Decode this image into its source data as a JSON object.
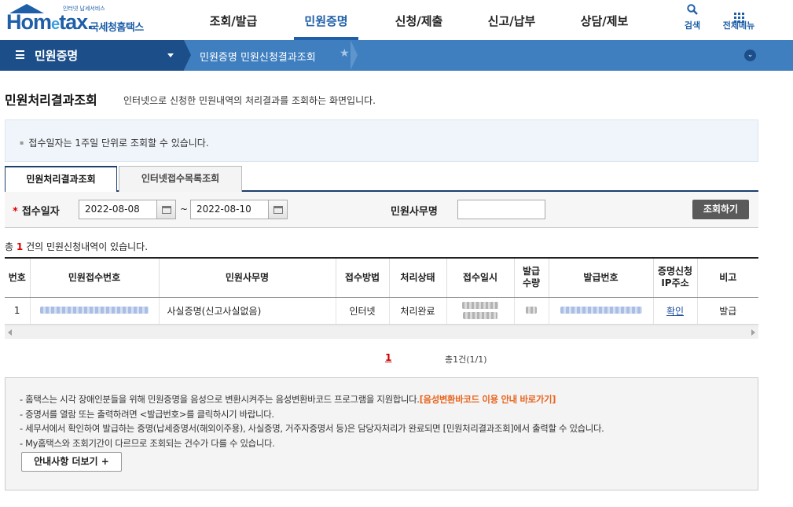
{
  "header": {
    "logo_small": "인터넷 납세서비스",
    "logo_word_a": "Hom",
    "logo_word_e": "e",
    "logo_word_b": "tax.",
    "logo_name": "국세청홈택스",
    "nav": [
      "조회/발급",
      "민원증명",
      "신청/제출",
      "신고/납부",
      "상담/제보"
    ],
    "active_nav": "민원증명",
    "search_label": "검색",
    "allmenu_label": "전체메뉴"
  },
  "location": {
    "depth1": "민원증명",
    "crumb": "민원증명 민원신청결과조회"
  },
  "page": {
    "title": "민원처리결과조회",
    "description": "인터넷으로 신청한 민원내역의 처리결과를 조회하는 화면입니다."
  },
  "info_text": "접수일자는 1주일 단위로 조회할 수 있습니다.",
  "tabs": [
    "민원처리결과조회",
    "인터넷접수목록조회"
  ],
  "search": {
    "date_label": "접수일자",
    "required_mark": "*",
    "date_from": "2022-08-08",
    "date_to": "2022-08-10",
    "tilde": "~",
    "name_label": "민원사무명",
    "name_value": "",
    "button": "조회하기"
  },
  "summary": {
    "prefix": "총",
    "count": "1",
    "suffix": "건의 민원신청내역이 있습니다."
  },
  "table": {
    "headers": [
      "번호",
      "민원접수번호",
      "민원사무명",
      "접수방법",
      "처리상태",
      "접수일시",
      "발급\n수량",
      "발급번호",
      "증명신청\nIP주소",
      "비고"
    ],
    "rows": [
      {
        "no": "1",
        "service": "사실증명(신고사실없음)",
        "method": "인터넷",
        "status": "처리완료",
        "ip_link": "확인",
        "note": "발급"
      }
    ]
  },
  "paging": {
    "current": "1",
    "info": "총1건(1/1)"
  },
  "guide": {
    "items": [
      "홈택스는 시각 장애인분들을 위해 민원증명을 음성으로 변환시켜주는 음성변환바코드 프로그램을 지원합니다.",
      "증명서를 열람 또는 출력하려면 <발급번호>를 클릭하시기 바랍니다.",
      "세무서에서 확인하여 발급하는 증명(납세증명서(해외이주용), 사실증명, 거주자증명서 등)은 담당자처리가 완료되면 [민원처리결과조회]에서 출력할 수 있습니다.",
      "My홈택스와 조회기간이 다르므로 조회되는 건수가 다를 수 있습니다."
    ],
    "highlight_link": "[음성변환바코드 이용 안내 바로가기]",
    "more_button": "안내사항 더보기 +"
  },
  "colors": {
    "brand_blue": "#1f5fa8",
    "location_bar": "#3f7fc0",
    "location_dark": "#1c4f8a",
    "required": "#dd0000",
    "highlight": "#e8641e"
  }
}
